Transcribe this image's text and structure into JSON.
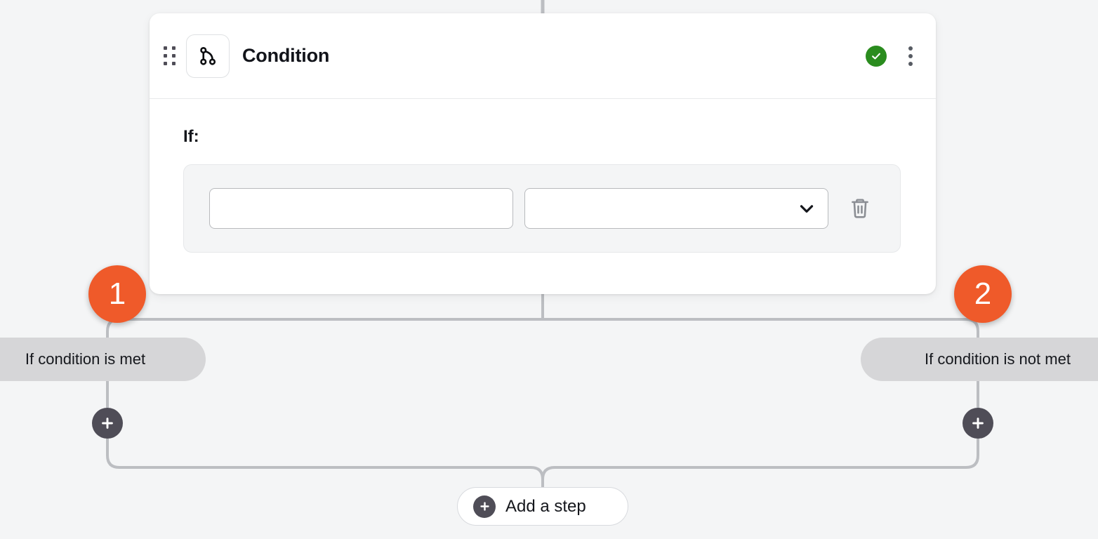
{
  "node": {
    "title": "Condition",
    "icon": "git-branch-icon",
    "drag_handle": "drag-handle-icon",
    "status": "valid",
    "status_icon": "check-circle-icon",
    "menu_icon": "kebab-menu-icon"
  },
  "body": {
    "if_label": "If:",
    "condition_row": {
      "left_field": {
        "value": "",
        "placeholder": ""
      },
      "operator_select": {
        "value": "",
        "placeholder": "",
        "options": [
          ""
        ],
        "icon": "chevron-down-icon"
      },
      "delete_icon": "trash-icon"
    }
  },
  "branches": [
    {
      "badge": "1",
      "label": "If condition is met",
      "add_icon": "plus-icon"
    },
    {
      "badge": "2",
      "label": "If condition is not met",
      "add_icon": "plus-icon"
    }
  ],
  "footer": {
    "add_step_label": "Add a step",
    "add_step_icon": "plus-circle-icon"
  },
  "colors": {
    "canvas_background": "#f4f5f6",
    "card_background": "#ffffff",
    "badge_orange": "#ef5a2a",
    "status_green": "#2a8c1e",
    "plus_dark": "#4f4d57",
    "pill_gray": "#d6d6d8",
    "connector_gray": "#bcbec2"
  }
}
